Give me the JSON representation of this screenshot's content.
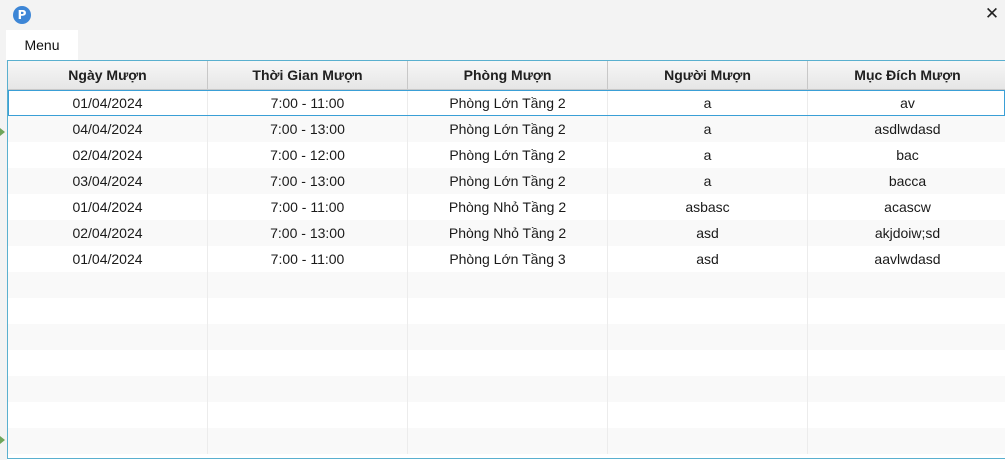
{
  "window": {
    "app_icon_glyph": "P",
    "close_glyph": "✕"
  },
  "menu": {
    "items": [
      {
        "label": "Menu"
      }
    ]
  },
  "table": {
    "columns": [
      "Ngày Mượn",
      "Thời Gian Mượn",
      "Phòng Mượn",
      "Người Mượn",
      "Mục Đích Mượn"
    ],
    "rows": [
      [
        "01/04/2024",
        "7:00 - 11:00",
        "Phòng Lớn Tầng 2",
        "a",
        "av"
      ],
      [
        "04/04/2024",
        "7:00 - 13:00",
        "Phòng Lớn Tầng 2",
        "a",
        "asdlwdasd"
      ],
      [
        "02/04/2024",
        "7:00 - 12:00",
        "Phòng Lớn Tầng 2",
        "a",
        "bac"
      ],
      [
        "03/04/2024",
        "7:00 - 13:00",
        "Phòng Lớn Tầng 2",
        "a",
        "bacca"
      ],
      [
        "01/04/2024",
        "7:00 - 11:00",
        "Phòng Nhỏ Tầng 2",
        "asbasc",
        "acascw"
      ],
      [
        "02/04/2024",
        "7:00 - 13:00",
        "Phòng Nhỏ Tầng 2",
        "asd",
        "akjdoiw;sd"
      ],
      [
        "01/04/2024",
        "7:00 - 11:00",
        "Phòng Lớn Tầng 3",
        "asd",
        "aavlwdasd"
      ]
    ],
    "selected_row": 0,
    "empty_rows": 7
  },
  "colors": {
    "app_icon": "#3d86d6",
    "table_border": "#5ab0cf",
    "selection": "#3a9fd6",
    "side_marker": "#6fa55a"
  }
}
